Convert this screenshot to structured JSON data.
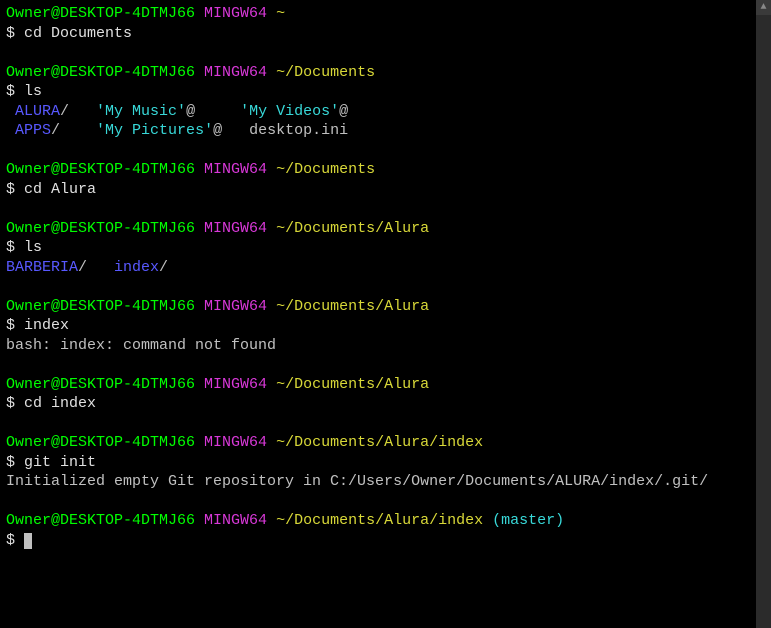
{
  "prompts": [
    {
      "user_host": "Owner@DESKTOP-4DTMJ66",
      "shell": "MINGW64",
      "path": "~",
      "branch": "",
      "cmd": "cd Documents"
    },
    {
      "user_host": "Owner@DESKTOP-4DTMJ66",
      "shell": "MINGW64",
      "path": "~/Documents",
      "branch": "",
      "cmd": "ls"
    },
    {
      "user_host": "Owner@DESKTOP-4DTMJ66",
      "shell": "MINGW64",
      "path": "~/Documents",
      "branch": "",
      "cmd": "cd Alura"
    },
    {
      "user_host": "Owner@DESKTOP-4DTMJ66",
      "shell": "MINGW64",
      "path": "~/Documents/Alura",
      "branch": "",
      "cmd": "ls"
    },
    {
      "user_host": "Owner@DESKTOP-4DTMJ66",
      "shell": "MINGW64",
      "path": "~/Documents/Alura",
      "branch": "",
      "cmd": "index"
    },
    {
      "user_host": "Owner@DESKTOP-4DTMJ66",
      "shell": "MINGW64",
      "path": "~/Documents/Alura",
      "branch": "",
      "cmd": "cd index"
    },
    {
      "user_host": "Owner@DESKTOP-4DTMJ66",
      "shell": "MINGW64",
      "path": "~/Documents/Alura/index",
      "branch": "",
      "cmd": "git init"
    },
    {
      "user_host": "Owner@DESKTOP-4DTMJ66",
      "shell": "MINGW64",
      "path": "~/Documents/Alura/index",
      "branch": "(master)",
      "cmd": ""
    }
  ],
  "dollar": "$ ",
  "ls1": {
    "l1_dir1": " ALURA",
    "l1_slash1": "/   ",
    "l1_link1": "'My Music'",
    "l1_at1": "@     ",
    "l1_link2": "'My Videos'",
    "l1_at2": "@",
    "l2_dir1": " APPS",
    "l2_slash1": "/    ",
    "l2_link1": "'My Pictures'",
    "l2_at1": "@   ",
    "l2_file": "desktop.ini"
  },
  "ls2": {
    "dir1": "BARBERIA",
    "slash1": "/   ",
    "dir2": "index",
    "slash2": "/"
  },
  "err": "bash: index: command not found",
  "git_init": "Initialized empty Git repository in C:/Users/Owner/Documents/ALURA/index/.git/"
}
